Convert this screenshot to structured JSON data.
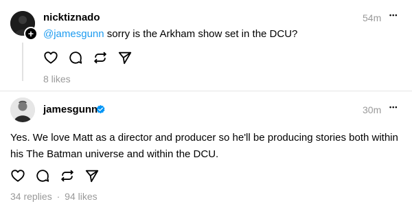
{
  "post1": {
    "username": "nicktiznado",
    "time": "54m",
    "mention": "@jamesgunn",
    "text": " sorry is the Arkham show set in the DCU?",
    "likes": "8 likes"
  },
  "post2": {
    "username": "jamesgunn",
    "time": "30m",
    "text": "Yes. We love Matt as a director and producer so he'll be producing stories both within his The Batman universe and within the DCU.",
    "replies": "34 replies",
    "separator": "·",
    "likes": "94 likes"
  },
  "icons": {
    "more": "more-icon",
    "like": "heart-icon",
    "reply": "comment-icon",
    "repost": "repost-icon",
    "share": "send-icon",
    "verified": "verified-badge-icon",
    "follow": "plus-icon"
  },
  "more_glyph": "•••",
  "plus_glyph": "+"
}
